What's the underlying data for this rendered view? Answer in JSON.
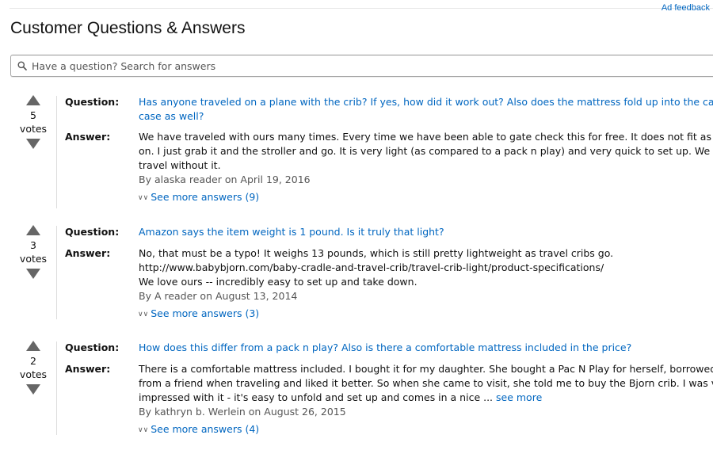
{
  "ad_feedback": "Ad feedback",
  "page_title": "Customer Questions & Answers",
  "search": {
    "placeholder": "Have a question? Search for answers",
    "value": ""
  },
  "labels": {
    "question": "Question:",
    "answer": "Answer:"
  },
  "colors": {
    "link": "#0066c0",
    "byline": "#555555",
    "arrow": "#666666"
  },
  "qa": [
    {
      "votes": "5",
      "votes_label": "votes",
      "question_lines": [
        "Has anyone traveled on a plane with the crib? If yes, how did it work out? Also does the mattress fold up into the carry",
        "case as well?"
      ],
      "answer_lines": [
        "We have traveled with ours many times. Every time we have been able to gate check this for free. It does not fit as a c",
        "on. I just grab it and the stroller and go. It is very light (as compared to a pack n play) and very quick to set up. We do",
        "travel without it."
      ],
      "answer_see_more": "",
      "byline": "By alaska reader on April 19, 2016",
      "see_more_answers": "See more answers (9)"
    },
    {
      "votes": "3",
      "votes_label": "votes",
      "question_lines": [
        "Amazon says the item weight is 1 pound. Is it truly that light?"
      ],
      "answer_lines": [
        "No, that must be a typo! It weighs 13 pounds, which is still pretty lightweight as travel cribs go.",
        "http://www.babybjorn.com/baby-cradle-and-travel-crib/travel-crib-light/product-specifications/",
        "We love ours -- incredibly easy to set up and take down."
      ],
      "answer_see_more": "",
      "byline": "By A reader on August 13, 2014",
      "see_more_answers": "See more answers (3)"
    },
    {
      "votes": "2",
      "votes_label": "votes",
      "question_lines": [
        "How does this differ from a pack n play? Also is there a comfortable mattress included in the price?"
      ],
      "answer_lines": [
        "There is a comfortable mattress included. I bought it for my daughter. She bought a Pac N Play for herself, borrowed th",
        "from a friend when traveling and liked it better. So when she came to visit, she told me to buy the Bjorn crib. I was ve",
        "impressed with it - it's easy to unfold and set up and comes in a nice ..."
      ],
      "answer_see_more": "see more",
      "byline": "By kathryn b. Werlein on August 26, 2015",
      "see_more_answers": "See more answers (4)"
    }
  ]
}
